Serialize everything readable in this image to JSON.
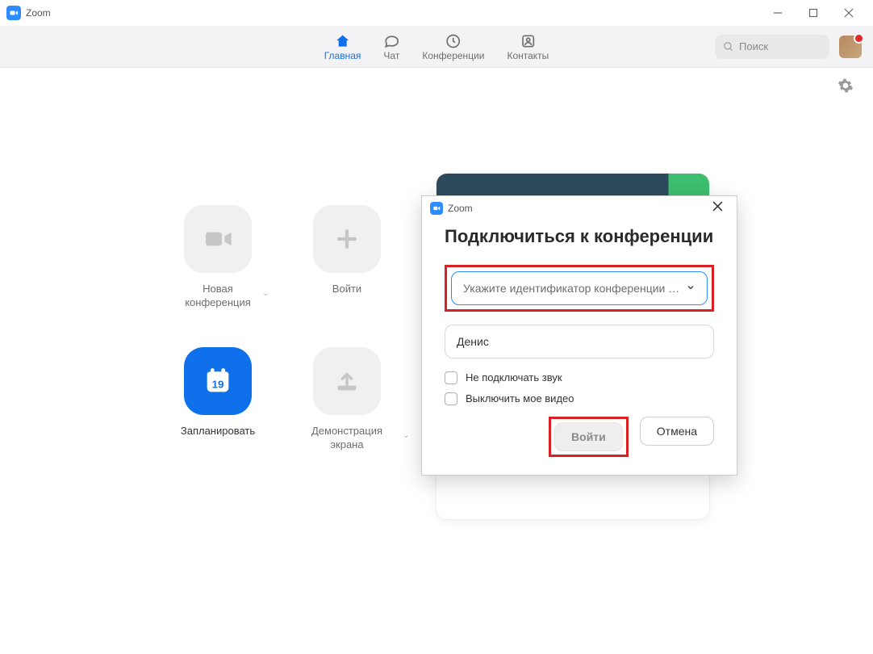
{
  "window": {
    "title": "Zoom"
  },
  "nav": {
    "items": [
      {
        "label": "Главная"
      },
      {
        "label": "Чат"
      },
      {
        "label": "Конференции"
      },
      {
        "label": "Контакты"
      }
    ],
    "search_placeholder": "Поиск"
  },
  "tiles": {
    "new_meeting": "Новая\nконференция",
    "join": "Войти",
    "schedule": "Запланировать",
    "schedule_day": "19",
    "share_screen": "Демонстрация\nэкрана"
  },
  "dialog": {
    "app": "Zoom",
    "heading": "Подключиться к конференции",
    "id_placeholder": "Укажите идентификатор конференции …",
    "name_value": "Денис",
    "chk_no_audio": "Не подключать звук",
    "chk_no_video": "Выключить мое видео",
    "join_btn": "Войти",
    "cancel_btn": "Отмена"
  }
}
